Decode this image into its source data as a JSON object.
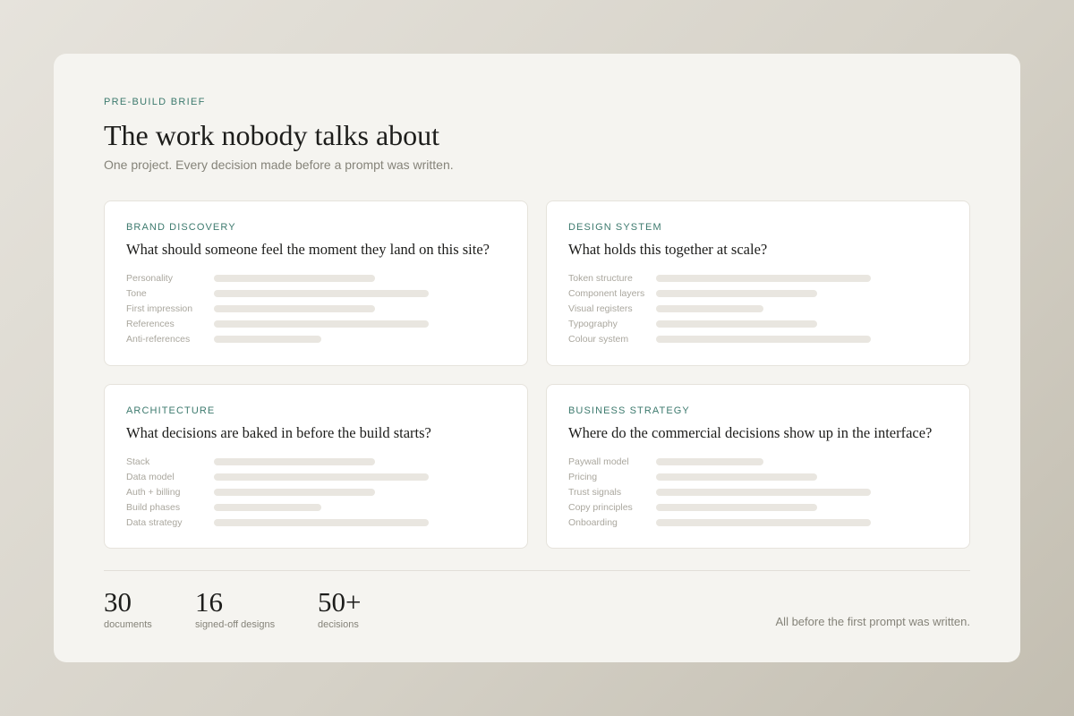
{
  "header": {
    "eyebrow": "PRE-BUILD BRIEF",
    "title": "The work nobody talks about",
    "subtitle": "One project. Every decision made before a prompt was written."
  },
  "cards": [
    {
      "label": "BRAND DISCOVERY",
      "question": "What should someone feel the moment they land on this site?",
      "rows": [
        {
          "label": "Personality",
          "fill": 0.75
        },
        {
          "label": "Tone",
          "fill": 1.0
        },
        {
          "label": "First impression",
          "fill": 0.75
        },
        {
          "label": "References",
          "fill": 1.0
        },
        {
          "label": "Anti-references",
          "fill": 0.5
        }
      ]
    },
    {
      "label": "DESIGN SYSTEM",
      "question": "What holds this together at scale?",
      "rows": [
        {
          "label": "Token structure",
          "fill": 1.0
        },
        {
          "label": "Component layers",
          "fill": 0.75
        },
        {
          "label": "Visual registers",
          "fill": 0.5
        },
        {
          "label": "Typography",
          "fill": 0.75
        },
        {
          "label": "Colour system",
          "fill": 1.0
        }
      ]
    },
    {
      "label": "ARCHITECTURE",
      "question": "What decisions are baked in before the build starts?",
      "rows": [
        {
          "label": "Stack",
          "fill": 0.75
        },
        {
          "label": "Data model",
          "fill": 1.0
        },
        {
          "label": "Auth + billing",
          "fill": 0.75
        },
        {
          "label": "Build phases",
          "fill": 0.5
        },
        {
          "label": "Data strategy",
          "fill": 1.0
        }
      ]
    },
    {
      "label": "BUSINESS STRATEGY",
      "question": "Where do the commercial decisions show up in the interface?",
      "rows": [
        {
          "label": "Paywall model",
          "fill": 0.5
        },
        {
          "label": "Pricing",
          "fill": 0.75
        },
        {
          "label": "Trust signals",
          "fill": 1.0
        },
        {
          "label": "Copy principles",
          "fill": 0.75
        },
        {
          "label": "Onboarding",
          "fill": 1.0
        }
      ]
    }
  ],
  "stats": [
    {
      "value": "30",
      "label": "documents"
    },
    {
      "value": "16",
      "label": "signed-off designs"
    },
    {
      "value": "50+",
      "label": "decisions"
    }
  ],
  "footnote": "All before the first prompt was written.",
  "colors": {
    "accent": "#3d7a6e",
    "bar": "#e9e6e0"
  }
}
